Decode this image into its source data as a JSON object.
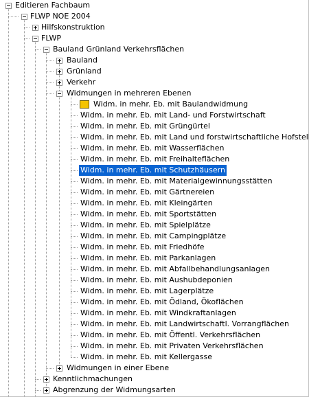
{
  "colors": {
    "selection": "#0a64d2",
    "leaf_icon": "#f5c400"
  },
  "tree": {
    "root": "Editieren Fachbaum",
    "flwp_noe": "FLWP NOE 2004",
    "hilfskonstruktion": "Hilfskonstruktion",
    "flwp": "FLWP",
    "bauland_gruenland": "Bauland Grünland Verkehrsflächen",
    "bauland": "Bauland",
    "gruenland": "Grünland",
    "verkehr": "Verkehr",
    "widmungen_mehrere": "Widmungen in mehreren Ebenen",
    "widm_items": [
      "Widm. in mehr. Eb. mit Baulandwidmung",
      "Widm. in mehr. Eb. mit Land- und Forstwirtschaft",
      "Widm. in mehr. Eb. mit Grüngürtel",
      "Widm. in mehr. Eb. mit Land und forstwirtschaftliche Hofstellen",
      "Widm. in mehr. Eb. mit Wasserflächen",
      "Widm. in mehr. Eb. mit Freihalteflächen",
      "Widm. in mehr. Eb. mit Schutzhäusern",
      "Widm. in mehr. Eb. mit Materialgewinnungsstätten",
      "Widm. in mehr. Eb. mit Gärtnereien",
      "Widm. in mehr. Eb. mit Kleingärten",
      "Widm. in mehr. Eb. mit Sportstätten",
      "Widm. in mehr. Eb. mit Spielplätze",
      "Widm. in mehr. Eb. mit Campingplätze",
      "Widm. in mehr. Eb. mit Friedhöfe",
      "Widm. in mehr. Eb. mit Parkanlagen",
      "Widm. in mehr. Eb. mit Abfallbehandlungsanlagen",
      "Widm. in mehr. Eb. mit Aushubdeponien",
      "Widm. in mehr. Eb. mit Lagerplätze",
      "Widm. in mehr. Eb. mit Ödland, Ökoflächen",
      "Widm. in mehr. Eb. mit Windkraftanlagen",
      "Widm. in mehr. Eb. mit Landwirtschaftl. Vorrangflächen",
      "Widm. in mehr. Eb. mit Öffentl. Verkehrsflächen",
      "Widm. in mehr. Eb. mit Privaten Verkehrsflächen",
      "Widm. in mehr. Eb. mit Kellergasse"
    ],
    "widmungen_einer": "Widmungen in einer Ebene",
    "kenntlichmachungen": "Kenntlichmachungen",
    "abgrenzung": "Abgrenzung der Widmungsarten",
    "selected_index": 6
  }
}
